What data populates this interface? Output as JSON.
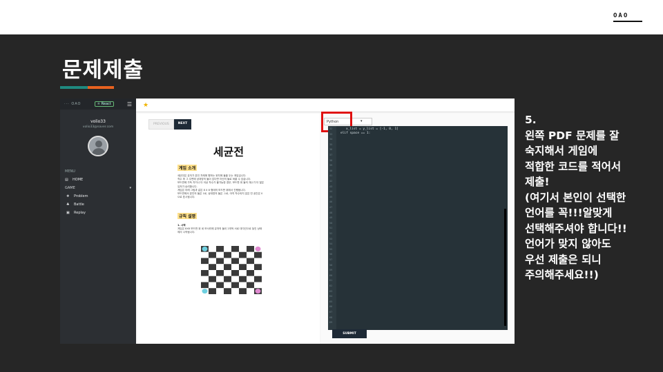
{
  "brand": {
    "mark": "OAO"
  },
  "slide": {
    "title": "문제제출"
  },
  "accent_colors": {
    "teal": "#1f8a80",
    "orange": "#e8621f"
  },
  "app": {
    "logo": "··· OAO",
    "framework_badge": "⚛ React",
    "user": {
      "name": "volio33",
      "email": "volio33@naver.com"
    },
    "nav": {
      "menu_header": "MENU",
      "home": "HOME",
      "game_header": "GAME",
      "game_chevron": "▾",
      "problem": "Problem",
      "battle": "Battle",
      "replay": "Replay"
    },
    "icons": {
      "home": "home-icon",
      "problem": "problem-icon",
      "battle": "battle-icon",
      "replay": "replay-icon",
      "star": "star-icon"
    }
  },
  "problem": {
    "prev_label": "PREVIOUS",
    "next_label": "NEXT",
    "title": "세균전",
    "section1": "게임 소개",
    "intro": [
      "세균전은 유저가 본인 차례에 원하는 위치에 돌을 두는 게임입니다.",
      "착수 후 그 주변에 상대방의 돌이 있다면 자신의 돌로 바꿀 수 있습니다.",
      "보드판에 가득 차거나 더 이상 착수가 불가능한 경우, 보드판 위 돌의 개수가 더 많은",
      "유저가 승리합니다.",
      "게임은 아래 그림과 같은 8 X 8 형태의 보드판 위에서 진행됩니다.",
      "보드판에서 본인의 돌은 1로, 상대방의 돌은 -1로, 아직 착수되지 않은 빈 공간은 0",
      "으로 표시됩니다."
    ],
    "section2": "규칙 설명",
    "rule_title": "1. 시작",
    "rule_text": [
      "게임은 8X8 보드판 위 네 모서리에 유저의 돌이 2개씩 서로 대각선으로 놓인 상태",
      "에서 시작됩니다."
    ]
  },
  "editor": {
    "language": "Python",
    "language_chevron": "▾",
    "line_numbers": [
      "32",
      "33",
      "34",
      "35",
      "36",
      "37",
      "38",
      "39",
      "40",
      "41",
      "42",
      "43",
      "44",
      "45",
      "46",
      "47",
      "48",
      "49",
      "50",
      "51",
      "52",
      "53",
      "54",
      "55",
      "56",
      "57",
      "58",
      "59",
      "60",
      "61",
      "62",
      "63",
      "64",
      "65",
      "66",
      "67",
      "68",
      "69"
    ],
    "code_lines": [
      "x_list = y_list = [-1, 0, 1]",
      "elif space == 1:"
    ],
    "submit_label": "SUBMIT"
  },
  "instruction": {
    "text": "5.\n왼쪽 PDF 문제를 잘\n숙지해서 게임에\n적합한 코드를 적어서\n제출!\n(여기서 본인이 선택한\n언어를 꼭!!!알맞게\n선택해주셔야 합니다!!\n언어가 맞지 않아도\n우선 제출은 되니\n주의해주세요!!)"
  }
}
